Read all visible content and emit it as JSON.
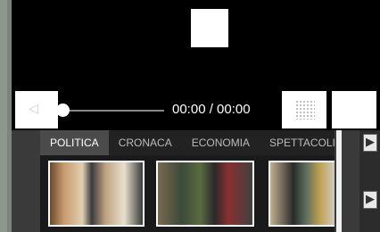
{
  "player": {
    "time_display": "00:00 / 00:00",
    "left_control_glyph": "◁",
    "progress": 0
  },
  "icons": {
    "stop": "stop-icon",
    "prev": "previous-icon",
    "volume": "volume-icon",
    "fullscreen": "fullscreen-icon",
    "scroll_right": "chevron-right-icon"
  },
  "tabs": [
    "POLITICA",
    "CRONACA",
    "ECONOMIA",
    "SPETTACOLI"
  ],
  "active_tab": "POLITICA",
  "arrow_glyph": "▶",
  "colors": {
    "background": "#000000",
    "tab_active": "#4b4b4b",
    "tab_text": "#bbbbbb",
    "frame": "#8f958f"
  }
}
